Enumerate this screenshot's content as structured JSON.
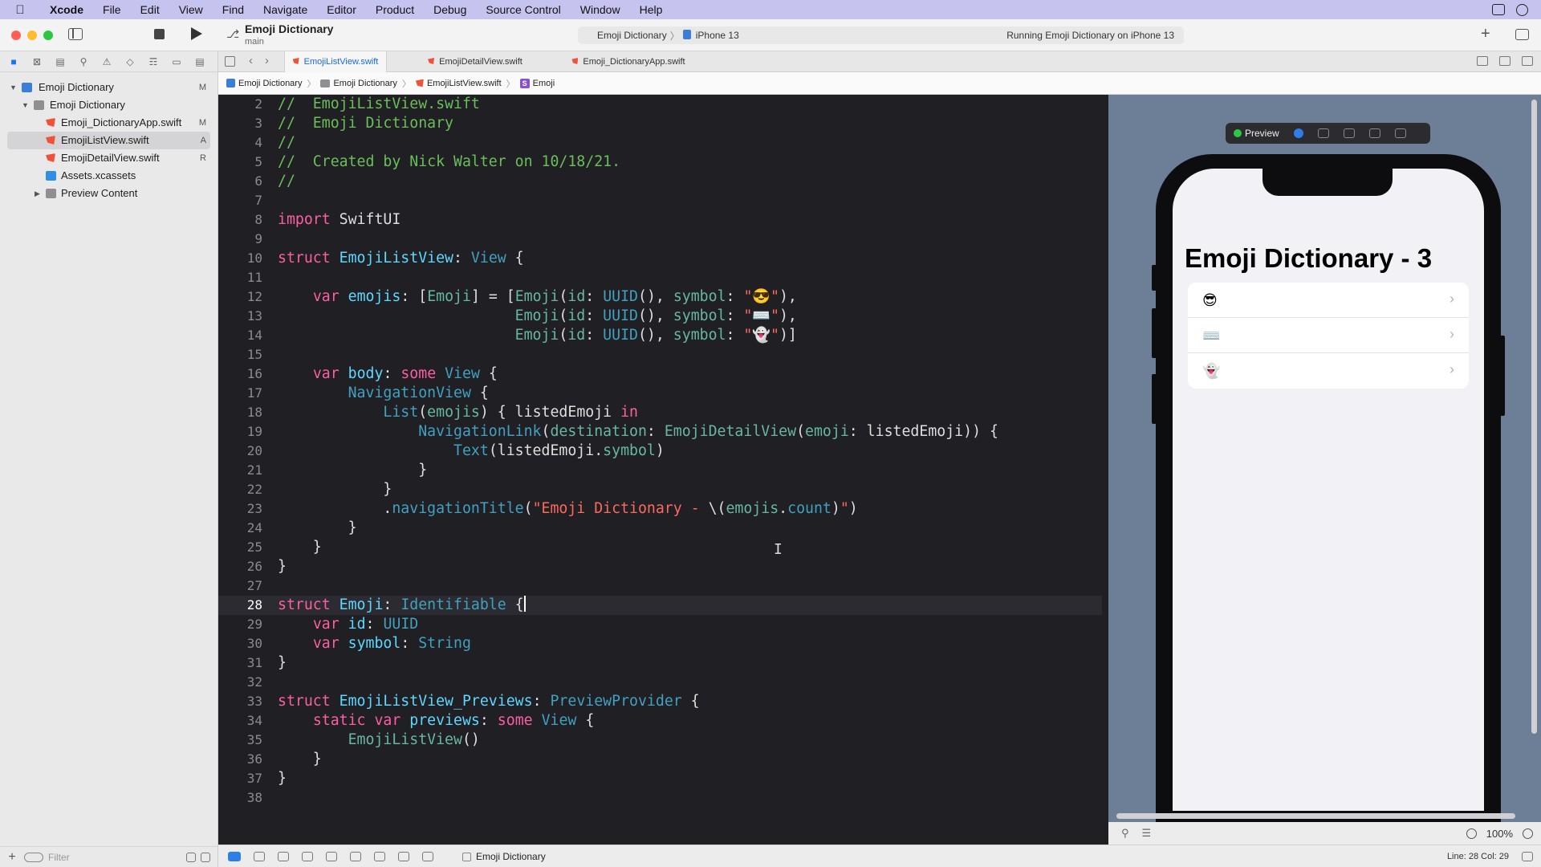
{
  "menubar": {
    "items": [
      "Xcode",
      "File",
      "Edit",
      "View",
      "Find",
      "Navigate",
      "Editor",
      "Product",
      "Debug",
      "Source Control",
      "Window",
      "Help"
    ]
  },
  "toolbar": {
    "project_title": "Emoji Dictionary",
    "branch": "main",
    "scheme": "Emoji Dictionary",
    "device": "iPhone 13",
    "status": "Running Emoji Dictionary on iPhone 13"
  },
  "navigator": {
    "items": [
      {
        "label": "Emoji Dictionary",
        "badge": "M"
      },
      {
        "label": "Emoji Dictionary",
        "badge": ""
      },
      {
        "label": "Emoji_DictionaryApp.swift",
        "badge": "M"
      },
      {
        "label": "EmojiListView.swift",
        "badge": "A"
      },
      {
        "label": "EmojiDetailView.swift",
        "badge": "R"
      },
      {
        "label": "Assets.xcassets",
        "badge": ""
      },
      {
        "label": "Preview Content",
        "badge": ""
      }
    ],
    "filter_placeholder": "Filter"
  },
  "tabs": [
    "EmojiListView.swift",
    "EmojiDetailView.swift",
    "Emoji_DictionaryApp.swift"
  ],
  "jumpbar": [
    "Emoji Dictionary",
    "Emoji Dictionary",
    "EmojiListView.swift",
    "Emoji"
  ],
  "editor": {
    "line_numbers": [
      "2",
      "3",
      "4",
      "5",
      "6",
      "7",
      "8",
      "9",
      "10",
      "11",
      "12",
      "13",
      "14",
      "15",
      "16",
      "17",
      "18",
      "19",
      "20",
      "21",
      "22",
      "23",
      "24",
      "25",
      "26",
      "27",
      "28",
      "29",
      "30",
      "31",
      "32",
      "33",
      "34",
      "35",
      "36",
      "37",
      "38"
    ],
    "current_line": "28"
  },
  "preview": {
    "label": "Preview",
    "nav_title": "Emoji Dictionary - 3",
    "rows": [
      "😎",
      "⌨️",
      "👻"
    ]
  },
  "canvas_footer": {
    "zoom": "100%"
  },
  "statusbar": {
    "target": "Emoji Dictionary",
    "line_col": "Line: 28  Col: 29"
  }
}
